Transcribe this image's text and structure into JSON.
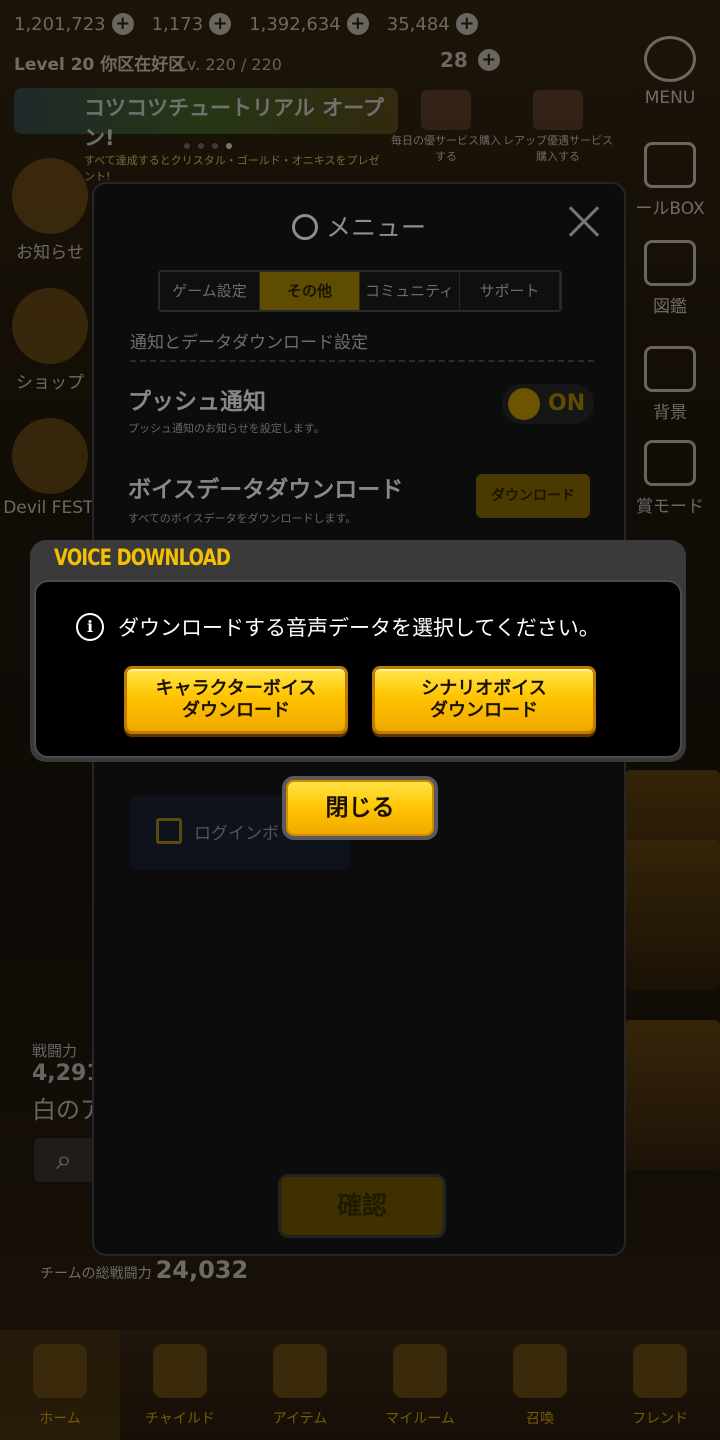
{
  "status_bar": {
    "currency": [
      "1,201,723",
      "1,173",
      "1,392,634",
      "35,484"
    ]
  },
  "player": {
    "level": "Level 20 你区在好区",
    "exp": "Lv. 220 / 220",
    "stamina": "28"
  },
  "banner": {
    "title": "コツコツチュートリアル オープン!",
    "subtitle": "すべて達成するとクリスタル・ゴールド・オニキスをプレゼント!",
    "items": [
      {
        "label": "毎日の優サービス購入する"
      },
      {
        "label": "レアップ優遇サービス購入する"
      }
    ]
  },
  "side_left": [
    {
      "label": "お知らせ"
    },
    {
      "label": "ショップ"
    },
    {
      "label": "Devil FEST."
    }
  ],
  "side_right": [
    {
      "label": "MENU"
    },
    {
      "label": "ールBOX"
    },
    {
      "label": "図鑑"
    },
    {
      "label": "背景"
    },
    {
      "label": "賞モード"
    }
  ],
  "combat": {
    "label": "戦闘力",
    "value": "4,291",
    "name": "白のア",
    "team_label": "チームの総戦闘力",
    "team_value": "24,032"
  },
  "bottom_nav": [
    {
      "label": "ホーム"
    },
    {
      "label": "チャイルド"
    },
    {
      "label": "アイテム"
    },
    {
      "label": "マイルーム"
    },
    {
      "label": "召喚"
    },
    {
      "label": "フレンド"
    }
  ],
  "menu": {
    "title": "メニュー",
    "tabs": [
      "ゲーム設定",
      "その他",
      "コミュニティ",
      "サポート"
    ],
    "active_tab": "その他",
    "section_title": "通知とデータダウンロード設定",
    "push": {
      "title": "プッシュ通知",
      "subtitle": "プッシュ通知のお知らせを設定します。",
      "state": "ON"
    },
    "voice": {
      "title": "ボイスデータダウンロード",
      "subtitle": "すべてのボイスデータをダウンロードします。",
      "button": "ダウンロード"
    },
    "login_row": "ログインボ",
    "confirm": "確認"
  },
  "voice_dialog": {
    "title": "VOICE DOWNLOAD",
    "message": "ダウンロードする音声データを選択してください。",
    "buttons": [
      {
        "line1": "キャラクターボイス",
        "line2": "ダウンロード"
      },
      {
        "line1": "シナリオボイス",
        "line2": "ダウンロード"
      }
    ],
    "close": "閉じる"
  },
  "colors": {
    "accent_gold": "#ffc400",
    "dialog_title": "#f4c000"
  }
}
